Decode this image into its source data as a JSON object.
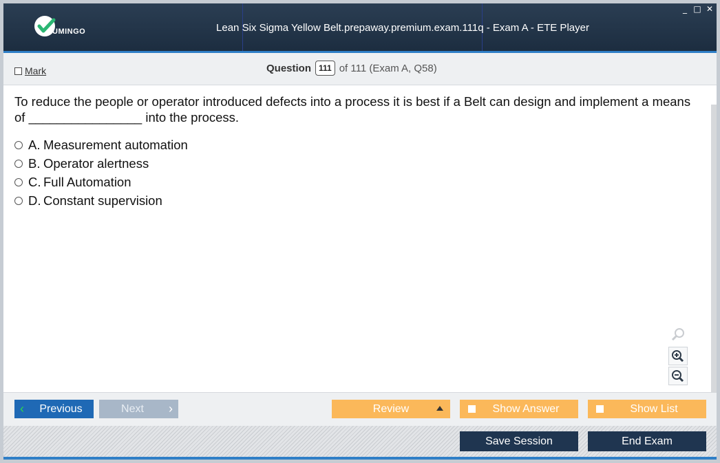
{
  "app": {
    "logo_text": "UMINGO",
    "window_title": "Lean Six Sigma Yellow Belt.prepaway.premium.exam.111q - Exam A - ETE Player",
    "window_controls": [
      "_",
      "□",
      "✕"
    ]
  },
  "header": {
    "mark_label": "Mark",
    "question_label": "Question",
    "question_number": "111",
    "question_of": "of 111 (Exam A, Q58)"
  },
  "question": {
    "text": "To reduce the people or operator introduced defects into a process it is best if a Belt can design and implement a means of ________________ into the process.",
    "options": [
      {
        "letter": "A.",
        "text": "Measurement automation"
      },
      {
        "letter": "B.",
        "text": "Operator alertness"
      },
      {
        "letter": "C.",
        "text": "Full Automation"
      },
      {
        "letter": "D.",
        "text": "Constant supervision"
      }
    ]
  },
  "zoom": {
    "icons": [
      "search-icon",
      "zoom-in-icon",
      "zoom-out-icon"
    ]
  },
  "nav": {
    "previous": "Previous",
    "next": "Next",
    "review": "Review",
    "show_answer": "Show Answer",
    "show_list": "Show List"
  },
  "footer": {
    "save_session": "Save Session",
    "end_exam": "End Exam"
  },
  "colors": {
    "titlebar": "#1c2d40",
    "accent_blue": "#2f7fc7",
    "previous_button": "#1f69b5",
    "next_button_disabled": "#a8b7c8",
    "orange_button": "#fbb85a",
    "dark_button": "#1f3550",
    "logo_green": "#2bb673"
  }
}
